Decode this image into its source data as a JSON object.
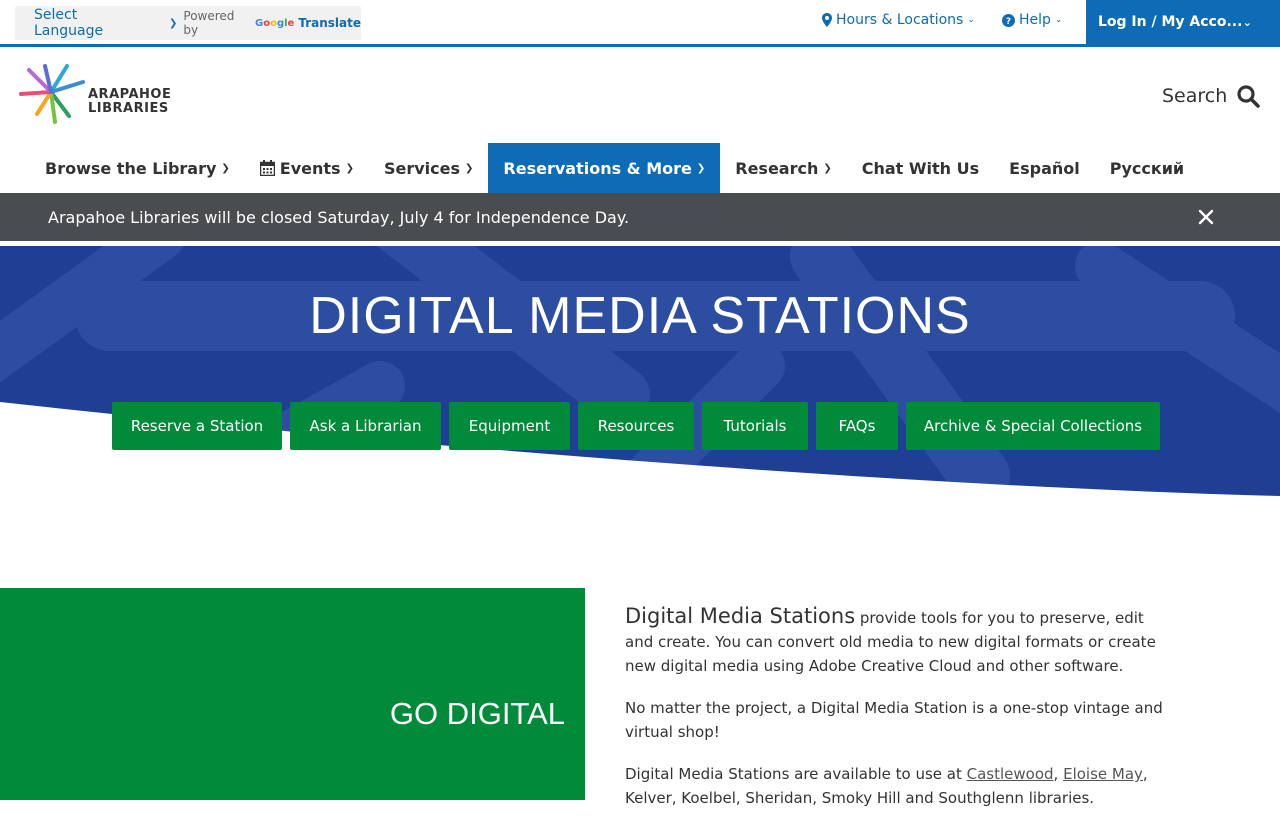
{
  "topbar": {
    "language_select": "Select Language",
    "powered_by": "Powered by",
    "google": "Google",
    "translate": "Translate",
    "hours": "Hours & Locations",
    "help": "Help",
    "login": "Log In / My Acco..."
  },
  "header": {
    "logo_line1": "ARAPAHOE",
    "logo_line2": "LIBRARIES",
    "search": "Search"
  },
  "nav": {
    "items": [
      {
        "label": "Browse the Library"
      },
      {
        "label": "Events"
      },
      {
        "label": "Services"
      },
      {
        "label": "Reservations & More"
      },
      {
        "label": "Research"
      },
      {
        "label": "Chat With Us"
      },
      {
        "label": "Español"
      },
      {
        "label": "Русский"
      }
    ]
  },
  "alert": {
    "text": "Arapahoe Libraries will be closed Saturday, July 4 for Independence Day."
  },
  "hero": {
    "title": "DIGITAL MEDIA STATIONS",
    "buttons": [
      {
        "label": "Reserve a Station"
      },
      {
        "label": "Ask a Librarian"
      },
      {
        "label": "Equipment"
      },
      {
        "label": "Resources"
      },
      {
        "label": "Tutorials"
      },
      {
        "label": "FAQs"
      },
      {
        "label": "Archive & Special Collections"
      }
    ]
  },
  "content": {
    "panel_title": "GO DIGITAL",
    "lead": "Digital Media Stations",
    "p1_rest": " provide tools for you to preserve, edit and create. You can convert old media to new digital formats or create new digital media using Adobe Creative Cloud and other software.",
    "p2": "No matter the project, a Digital Media Station is a one-stop vintage and virtual shop!",
    "p3_start": "Digital Media Stations are available to use at ",
    "link_castlewood": "Castlewood",
    "comma1": ", ",
    "link_eloise": "Eloise May",
    "comma2": ",",
    "p3_rest": "Kelver, Koelbel, Sheridan, Smoky Hill and Southglenn libraries."
  },
  "colors": {
    "brand_blue": "#0d6cb5",
    "green": "#008a3a",
    "alert_gray": "#4a4d50",
    "hero_blue": "#1f3f94"
  }
}
